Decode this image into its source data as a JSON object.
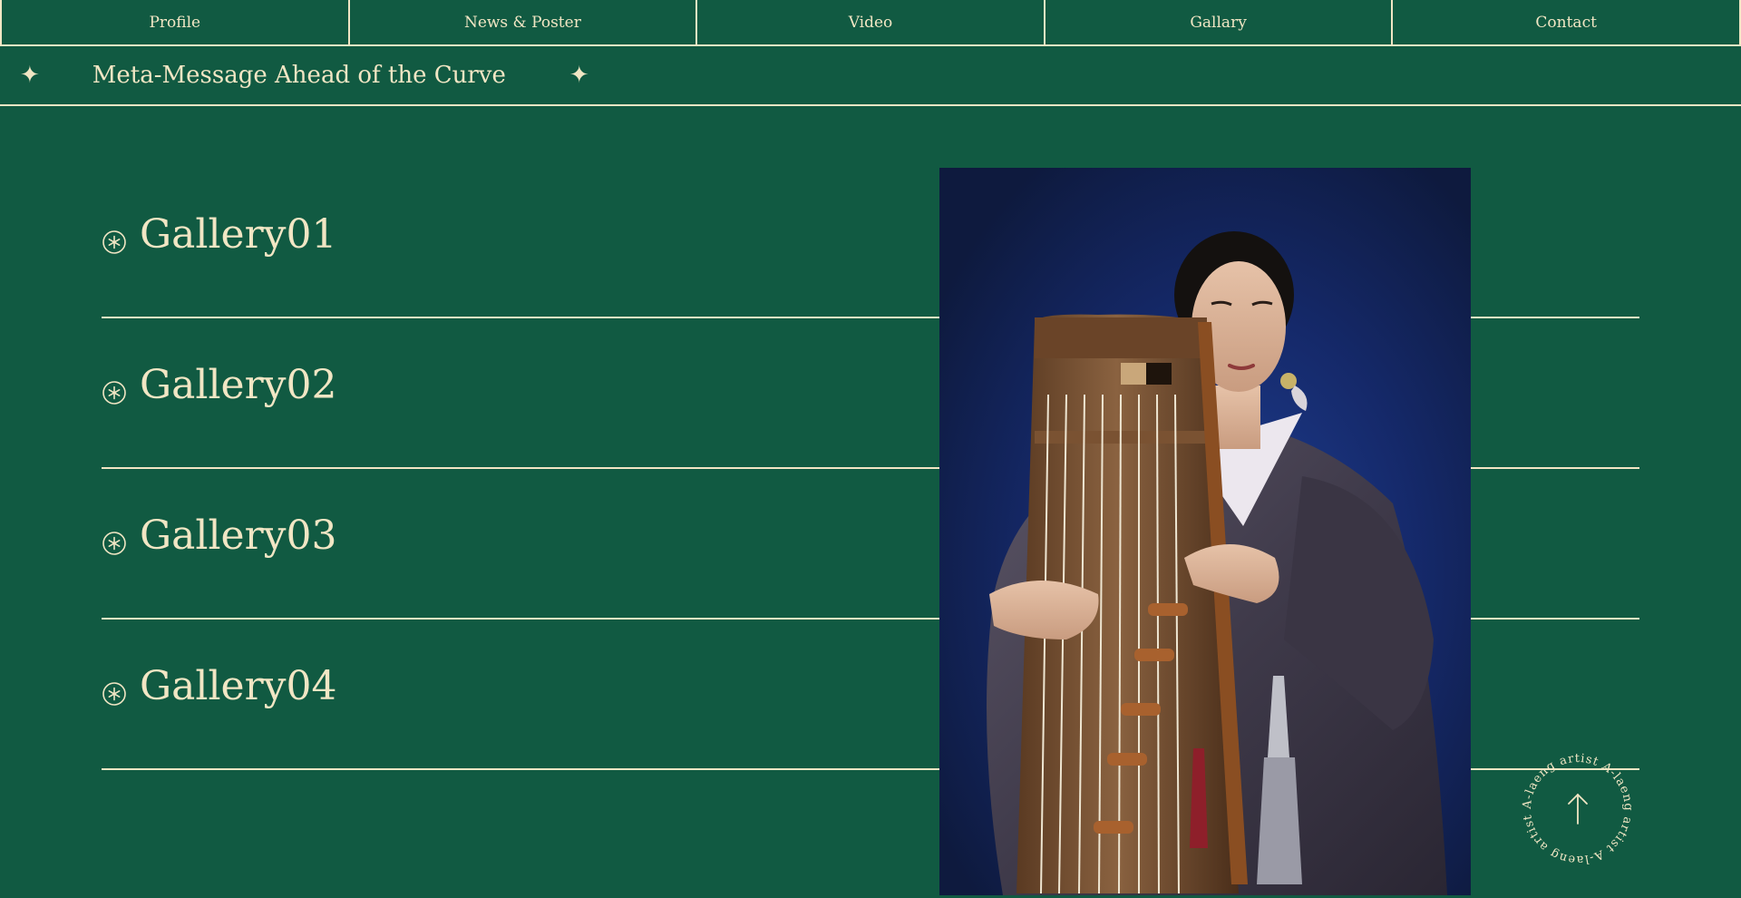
{
  "nav": {
    "items": [
      {
        "label": "Profile"
      },
      {
        "label": "News & Poster"
      },
      {
        "label": "Video"
      },
      {
        "label": "Gallary"
      },
      {
        "label": "Contact"
      }
    ]
  },
  "marquee": {
    "text": "Meta-Message Ahead of the Curve"
  },
  "galleries": [
    {
      "label": "Gallery01"
    },
    {
      "label": "Gallery02"
    },
    {
      "label": "Gallery03"
    },
    {
      "label": "Gallery04"
    }
  ],
  "scroll_top": {
    "ring_text": "A-laeng artist A-laeng artist A-laeng artist"
  },
  "colors": {
    "background": "#115A42",
    "cream": "#F1E6C4",
    "photo_backdrop": "#15296A"
  }
}
